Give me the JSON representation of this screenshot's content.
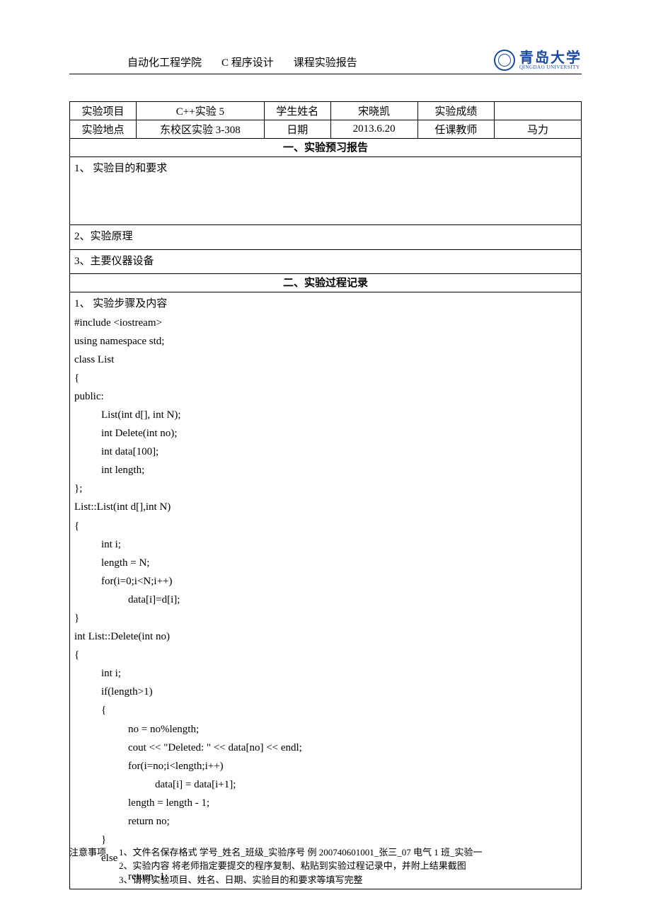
{
  "header": {
    "dept": "自动化工程学院",
    "course": "C 程序设计",
    "title": "课程实验报告",
    "logo_cn": "青岛大学",
    "logo_en": "QINGDAO  UNIVERSITY"
  },
  "info": {
    "rows": [
      {
        "c1": "实验项目",
        "c2": "C++实验 5",
        "c3": "学生姓名",
        "c4": "宋晓凯",
        "c5": "实验成绩",
        "c6": ""
      },
      {
        "c1": "实验地点",
        "c2": "东校区实验 3-308",
        "c3": "日期",
        "c4": "2013.6.20",
        "c5": "任课教师",
        "c6": "马力"
      }
    ]
  },
  "section1": {
    "title": "一、实验预习报告",
    "item1": "1、 实验目的和要求",
    "item2": "2、实验原理",
    "item3": "3、主要仪器设备"
  },
  "section2": {
    "title": "二、实验过程记录",
    "heading": "1、 实验步骤及内容",
    "code": [
      {
        "t": "#include <iostream>",
        "i": 0
      },
      {
        "t": "using namespace std;",
        "i": 0
      },
      {
        "t": "class List",
        "i": 0
      },
      {
        "t": "{",
        "i": 0
      },
      {
        "t": "public:",
        "i": 0
      },
      {
        "t": "List(int d[], int N);",
        "i": 1
      },
      {
        "t": "int Delete(int no);",
        "i": 1
      },
      {
        "t": "int data[100];",
        "i": 1
      },
      {
        "t": "int length;",
        "i": 1
      },
      {
        "t": "};",
        "i": 0
      },
      {
        "t": "List::List(int d[],int N)",
        "i": 0
      },
      {
        "t": "{",
        "i": 0
      },
      {
        "t": "int i;",
        "i": 1
      },
      {
        "t": "length = N;",
        "i": 1
      },
      {
        "t": "for(i=0;i<N;i++)",
        "i": 1
      },
      {
        "t": "data[i]=d[i];",
        "i": 2
      },
      {
        "t": "}",
        "i": 0
      },
      {
        "t": "int List::Delete(int no)",
        "i": 0
      },
      {
        "t": "{",
        "i": 0
      },
      {
        "t": "int i;",
        "i": 1
      },
      {
        "t": "if(length>1)",
        "i": 1
      },
      {
        "t": "{",
        "i": 1
      },
      {
        "t": "no = no%length;",
        "i": 2
      },
      {
        "t": "cout << \"Deleted: \" << data[no] << endl;",
        "i": 2
      },
      {
        "t": "for(i=no;i<length;i++)",
        "i": 2
      },
      {
        "t": "data[i] = data[i+1];",
        "i": 3
      },
      {
        "t": "length = length - 1;",
        "i": 2
      },
      {
        "t": "return no;",
        "i": 2
      },
      {
        "t": "}",
        "i": 1
      },
      {
        "t": "else",
        "i": 1
      },
      {
        "t": "return -1;",
        "i": 2
      }
    ]
  },
  "footer": {
    "label": "注意事项",
    "lines": [
      "1、文件名保存格式  学号_姓名_班级_实验序号  例  200740601001_张三_07 电气 1 班_实验一",
      "2、实验内容  将老师指定要提交的程序复制、粘贴到实验过程记录中，并附上结果截图",
      "3、请将实验项目、姓名、日期、实验目的和要求等填写完整"
    ]
  }
}
